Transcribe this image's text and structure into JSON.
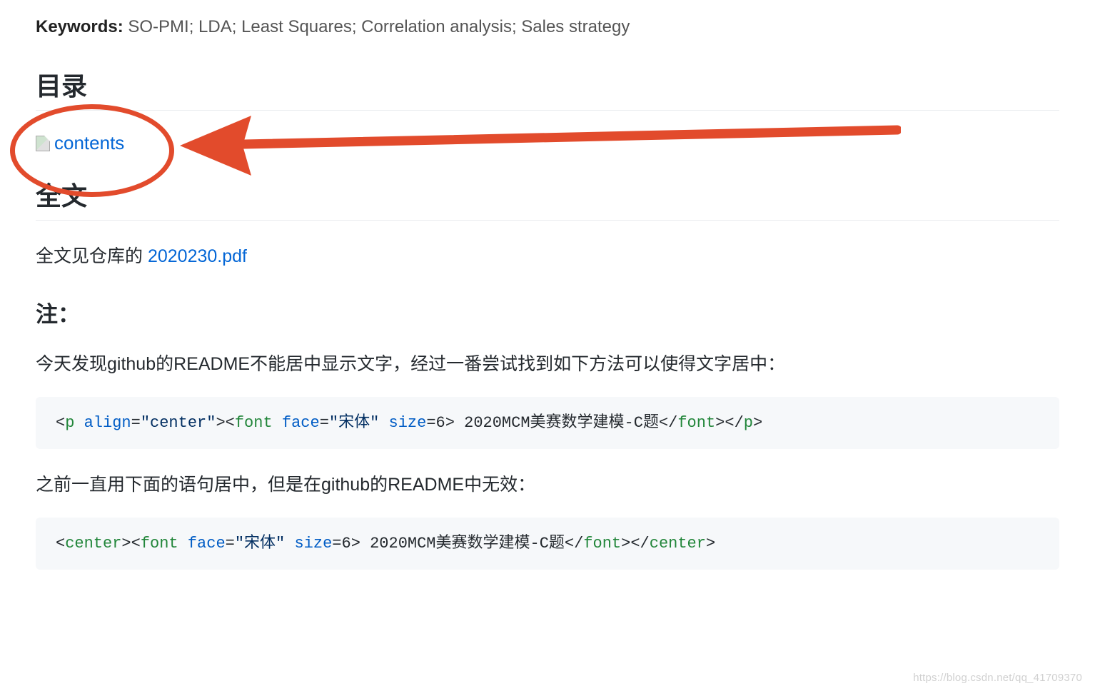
{
  "keywords": {
    "label": "Keywords:",
    "value": "SO-PMI; LDA; Least Squares; Correlation analysis; Sales strategy"
  },
  "sections": {
    "toc_heading": "目录",
    "broken_image_alt": "contents",
    "fulltext_heading": "全文",
    "fulltext_prefix": "全文见仓库的 ",
    "fulltext_link": "2020230.pdf",
    "note_heading": "注：",
    "note_para1": "今天发现github的README不能居中显示文字，经过一番尝试找到如下方法可以使得文字居中：",
    "note_para2": "之前一直用下面的语句居中，但是在github的README中无效："
  },
  "code1": {
    "lt1": "<",
    "tag_p_open": "p",
    "sp1": " ",
    "attr_align": "align",
    "eq1": "=",
    "str_center": "\"center\"",
    "gt1": ">",
    "lt2": "<",
    "tag_font_open": "font",
    "sp2": " ",
    "attr_face": "face",
    "eq2": "=",
    "str_face": "\"宋体\"",
    "sp3": " ",
    "attr_size": "size",
    "eq3": "=",
    "num_6": "6",
    "gt2": ">",
    "inner_text": " 2020MCM美赛数学建模-C题",
    "lt3": "</",
    "tag_font_close": "font",
    "gt3": ">",
    "lt4": "</",
    "tag_p_close": "p",
    "gt4": ">"
  },
  "code2": {
    "lt1": "<",
    "tag_center_open": "center",
    "gt1": ">",
    "lt2": "<",
    "tag_font_open": "font",
    "sp2": " ",
    "attr_face": "face",
    "eq2": "=",
    "str_face": "\"宋体\"",
    "sp3": " ",
    "attr_size": "size",
    "eq3": "=",
    "num_6": "6",
    "gt2": ">",
    "inner_text": " 2020MCM美赛数学建模-C题",
    "lt3": "</",
    "tag_font_close": "font",
    "gt3": ">",
    "lt4": "</",
    "tag_center_close": "center",
    "gt4": ">"
  },
  "annotation": {
    "arrow_color": "#E24B2C"
  },
  "watermark": "https://blog.csdn.net/qq_41709370"
}
